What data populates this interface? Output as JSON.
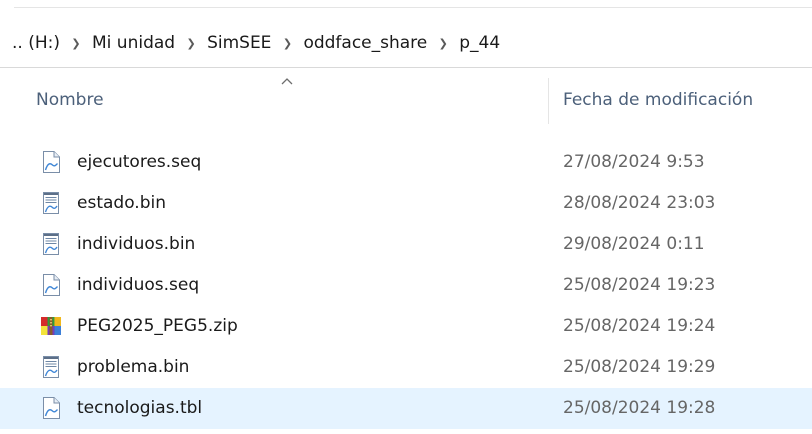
{
  "breadcrumb": {
    "items": [
      ".. (H:)",
      "Mi unidad",
      "SimSEE",
      "oddface_share",
      "p_44"
    ]
  },
  "columns": {
    "name": "Nombre",
    "date": "Fecha de modificación",
    "sorted_by": "Nombre",
    "sort_direction": "ascending"
  },
  "files": [
    {
      "name": "ejecutores.seq",
      "date": "27/08/2024 9:53",
      "icon": "generic-file-icon"
    },
    {
      "name": "estado.bin",
      "date": "28/08/2024 23:03",
      "icon": "binary-file-icon"
    },
    {
      "name": "individuos.bin",
      "date": "29/08/2024 0:11",
      "icon": "binary-file-icon"
    },
    {
      "name": "individuos.seq",
      "date": "25/08/2024 19:23",
      "icon": "generic-file-icon"
    },
    {
      "name": "PEG2025_PEG5.zip",
      "date": "25/08/2024 19:24",
      "icon": "zip-archive-icon"
    },
    {
      "name": "problema.bin",
      "date": "25/08/2024 19:29",
      "icon": "binary-file-icon"
    },
    {
      "name": "tecnologias.tbl",
      "date": "25/08/2024 19:28",
      "icon": "generic-file-icon"
    }
  ],
  "selected_file": "tecnologias.tbl",
  "colors": {
    "header_text": "#4c607a",
    "selection_bg": "#e5f3ff",
    "date_text": "#666666"
  }
}
